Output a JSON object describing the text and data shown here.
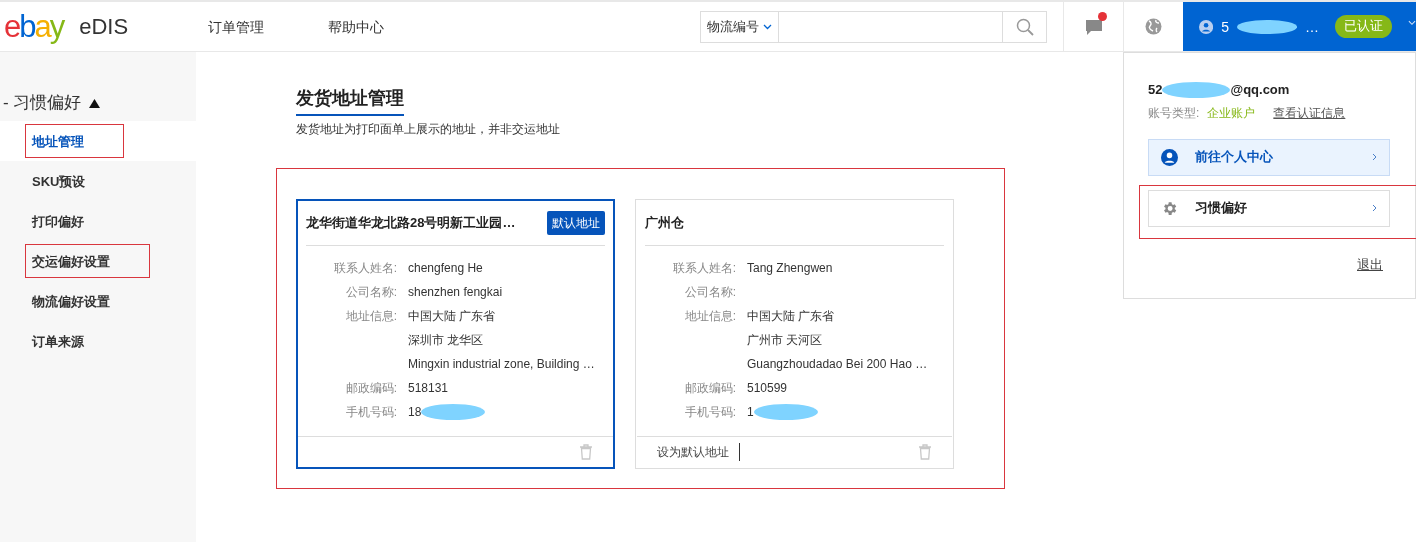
{
  "header": {
    "logo": "ebay",
    "app_name": "eDIS",
    "nav": [
      {
        "label": "订单管理"
      },
      {
        "label": "帮助中心"
      }
    ],
    "search": {
      "type_label": "物流编号"
    },
    "notifications": {
      "unread": true
    },
    "user": {
      "name_start": "5",
      "name_end": "…",
      "badge": "已认证"
    }
  },
  "sidebar": {
    "group": {
      "label": "- 习惯偏好",
      "expanded": true,
      "items": [
        {
          "label": "地址管理",
          "selected": true,
          "annotated": true
        },
        {
          "label": "SKU预设",
          "selected": false,
          "annotated": false
        },
        {
          "label": "打印偏好",
          "selected": false,
          "annotated": false
        },
        {
          "label": "交运偏好设置",
          "selected": false,
          "annotated": true
        },
        {
          "label": "物流偏好设置",
          "selected": false,
          "annotated": false
        },
        {
          "label": "订单来源",
          "selected": false,
          "annotated": false
        }
      ]
    }
  },
  "page": {
    "title": "发货地址管理",
    "subtitle": "发货地址为打印面单上展示的地址，并非交运地址",
    "annotated": true,
    "cards": [
      {
        "title": "龙华街道华龙北路28号明新工业园…",
        "default_badge": "默认地址",
        "selected": true,
        "fields": [
          {
            "label": "联系人姓名:",
            "lines": [
              "chengfeng He"
            ]
          },
          {
            "label": "公司名称:",
            "lines": [
              "shenzhen fengkai"
            ]
          },
          {
            "label": "地址信息:",
            "lines": [
              "中国大陆 广东省",
              "深圳市 龙华区",
              "Mingxin industrial zone, Building …"
            ]
          },
          {
            "label": "邮政编码:",
            "lines": [
              "518131"
            ]
          },
          {
            "label": "手机号码:",
            "lines": [
              "18"
            ],
            "redacted": true
          }
        ]
      },
      {
        "title": "广州仓",
        "selected": false,
        "set_default": "设为默认地址",
        "fields": [
          {
            "label": "联系人姓名:",
            "lines": [
              "Tang Zhengwen"
            ]
          },
          {
            "label": "公司名称:"
          },
          {
            "label": "地址信息:",
            "lines": [
              "中国大陆 广东省",
              "广州市 天河区",
              "Guangzhoudadao Bei 200 Hao …"
            ]
          },
          {
            "label": "邮政编码:",
            "lines": [
              "510599"
            ]
          },
          {
            "label": "手机号码:",
            "lines": [
              "1"
            ],
            "redacted": true
          }
        ]
      }
    ]
  },
  "user_menu": {
    "email_start": "52",
    "email_end": "@qq.com",
    "account_type_label": "账号类型:",
    "account_type": "企业账户",
    "cert_link": "查看认证信息",
    "items": [
      {
        "kind": "profile",
        "label": "前往个人中心",
        "annotated": false
      },
      {
        "kind": "settings",
        "label": "习惯偏好",
        "annotated": true
      }
    ],
    "logout": "退出"
  }
}
